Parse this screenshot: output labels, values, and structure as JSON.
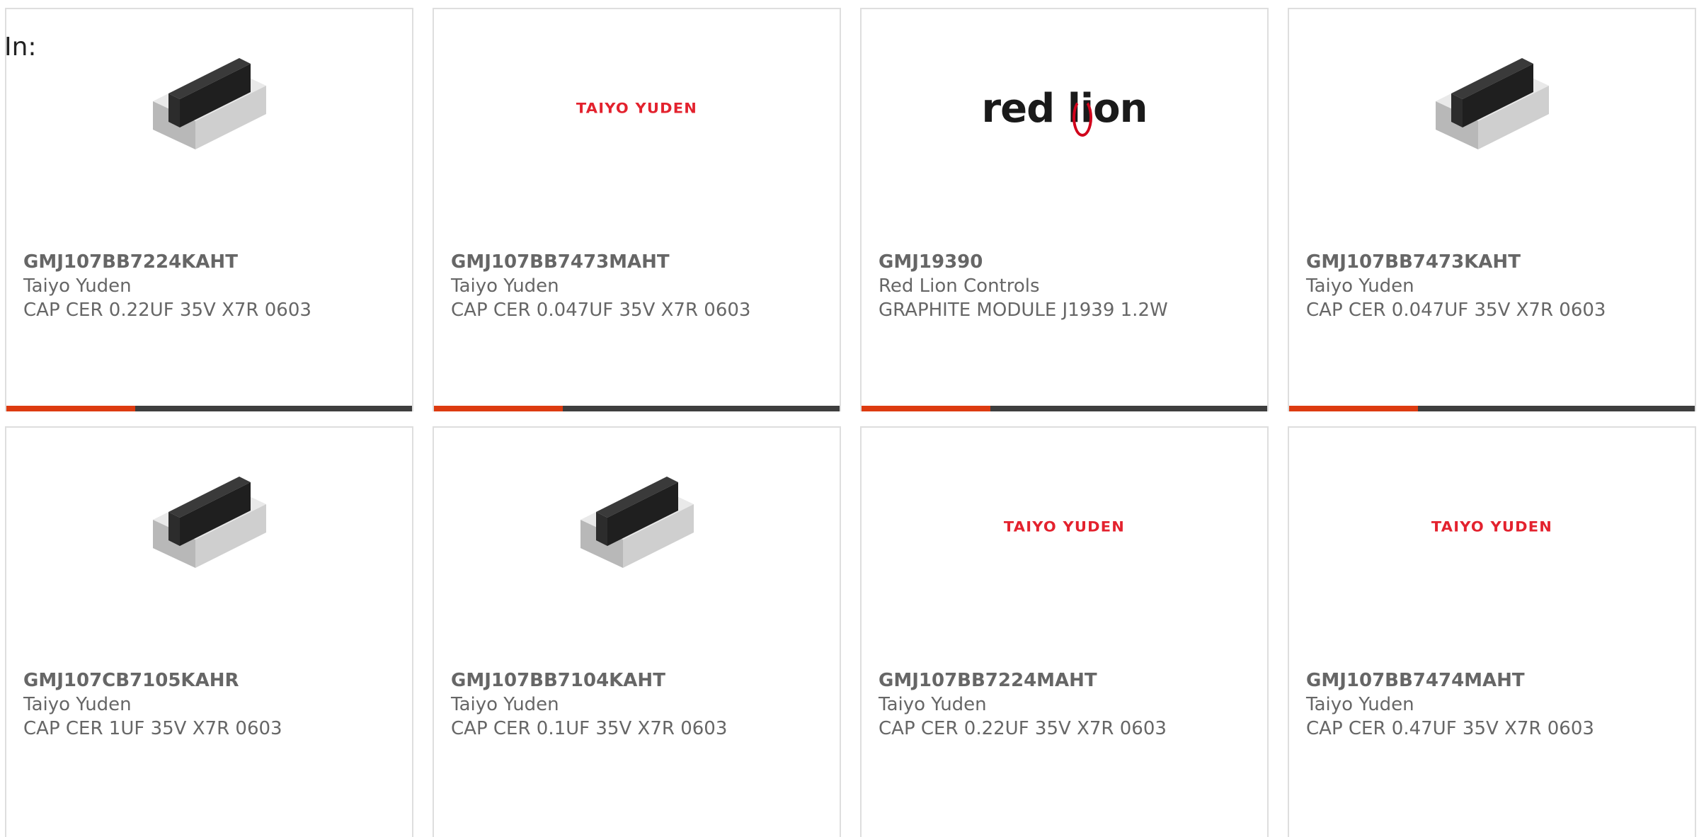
{
  "header": {
    "in_label": "In:"
  },
  "colors": {
    "accent": "#dd3b10",
    "bar": "#3e3e3e",
    "taiyo_red": "#e3222e",
    "text": "#666666"
  },
  "cards": [
    {
      "image": "capacitor-chip-image",
      "part_number": "GMJ107BB7224KAHT",
      "manufacturer": "Taiyo Yuden",
      "description": "CAP CER 0.22UF 35V X7R 0603"
    },
    {
      "image": "taiyo-yuden-logo",
      "logo_text": "TAIYO YUDEN",
      "part_number": "GMJ107BB7473MAHT",
      "manufacturer": "Taiyo Yuden",
      "description": "CAP CER 0.047UF 35V X7R 0603"
    },
    {
      "image": "red-lion-logo",
      "logo_text": "red lion",
      "part_number": "GMJ19390",
      "manufacturer": "Red Lion Controls",
      "description": "GRAPHITE MODULE J1939 1.2W"
    },
    {
      "image": "capacitor-chip-image",
      "part_number": "GMJ107BB7473KAHT",
      "manufacturer": "Taiyo Yuden",
      "description": "CAP CER 0.047UF 35V X7R 0603"
    },
    {
      "image": "capacitor-chip-image",
      "part_number": "GMJ107CB7105KAHR",
      "manufacturer": "Taiyo Yuden",
      "description": "CAP CER 1UF 35V X7R 0603"
    },
    {
      "image": "capacitor-chip-image",
      "part_number": "GMJ107BB7104KAHT",
      "manufacturer": "Taiyo Yuden",
      "description": "CAP CER 0.1UF 35V X7R 0603"
    },
    {
      "image": "taiyo-yuden-logo",
      "logo_text": "TAIYO YUDEN",
      "part_number": "GMJ107BB7224MAHT",
      "manufacturer": "Taiyo Yuden",
      "description": "CAP CER 0.22UF 35V X7R 0603"
    },
    {
      "image": "taiyo-yuden-logo",
      "logo_text": "TAIYO YUDEN",
      "part_number": "GMJ107BB7474MAHT",
      "manufacturer": "Taiyo Yuden",
      "description": "CAP CER 0.47UF 35V X7R 0603"
    }
  ]
}
